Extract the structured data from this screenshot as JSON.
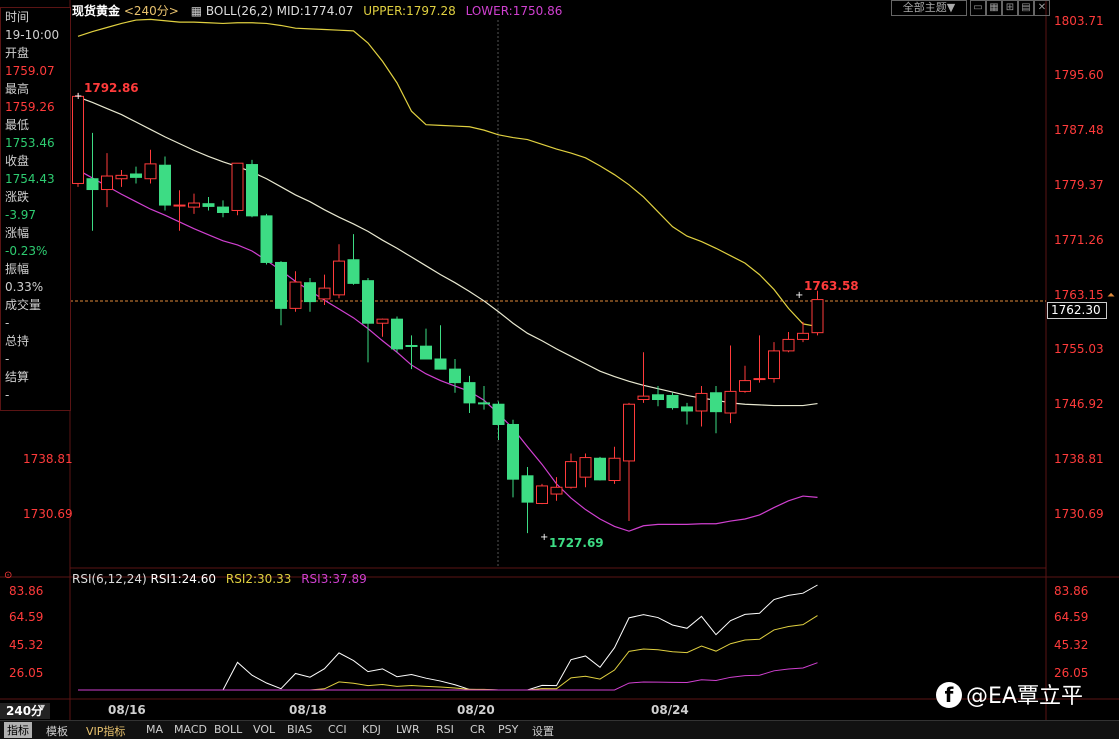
{
  "header": {
    "symbol": "现货黄金",
    "period": "<240分>",
    "boll_label": "BOLL(26,2)",
    "mid": "MID:1774.07",
    "upper": "UPPER:1797.28",
    "lower": "LOWER:1750.86",
    "theme_button": "全部主题▼"
  },
  "info_panel": {
    "time_label": "时间",
    "time_value": "19-10:00",
    "open_label": "开盘",
    "open_value": "1759.07",
    "high_label": "最高",
    "high_value": "1759.26",
    "low_label": "最低",
    "low_value": "1753.46",
    "close_label": "收盘",
    "close_value": "1754.43",
    "change_label": "涨跌",
    "change_value": "-3.97",
    "change_pct_label": "涨幅",
    "change_pct_value": "-0.23%",
    "amplitude_label": "振幅",
    "amplitude_value": "0.33%",
    "volume_label": "成交量",
    "volume_value": "-",
    "oi_label": "总持",
    "oi_value": "-",
    "settle_label": "结算",
    "settle_value": "-"
  },
  "right_axis": [
    "1803.71",
    "1795.60",
    "1787.48",
    "1779.37",
    "1771.26",
    "1763.15",
    "1755.03",
    "1746.92",
    "1738.81",
    "1730.69"
  ],
  "left_axis": [
    "1738.81",
    "1730.69"
  ],
  "current_price": "1762.30",
  "annotations": {
    "high_mark": "1792.86",
    "low_mark": "1727.69",
    "last_mark": "1763.58"
  },
  "rsi": {
    "label": "RSI(6,12,24)",
    "rsi1": "RSI1:24.60",
    "rsi2": "RSI2:30.33",
    "rsi3": "RSI3:37.89",
    "axis": [
      "83.86",
      "64.59",
      "45.32",
      "26.05"
    ]
  },
  "dates": [
    "08/16",
    "08/18",
    "08/20",
    "08/24"
  ],
  "period_button": "240分",
  "tabs": [
    "指标",
    "模板",
    "VIP指标",
    "MA",
    "MACD",
    "BOLL",
    "VOL",
    "BIAS",
    "CCI",
    "KDJ",
    "LWR",
    "RSI",
    "CR",
    "PSY",
    "设置"
  ],
  "watermark": "@EA覃立平",
  "colors": {
    "up": "#ff3b3b",
    "down": "#3ddc84",
    "mid": "#e8e8d0",
    "upper": "#e0d040",
    "lower": "#d040d0"
  },
  "chart_data": {
    "type": "candlestick",
    "candles": [
      {
        "o": 1779.5,
        "h": 1792.9,
        "l": 1779.0,
        "c": 1792.4
      },
      {
        "o": 1780.2,
        "h": 1787.0,
        "l": 1772.5,
        "c": 1778.6
      },
      {
        "o": 1778.6,
        "h": 1784.0,
        "l": 1776.0,
        "c": 1780.6
      },
      {
        "o": 1780.2,
        "h": 1781.5,
        "l": 1779.0,
        "c": 1780.7
      },
      {
        "o": 1780.9,
        "h": 1782.0,
        "l": 1779.5,
        "c": 1780.4
      },
      {
        "o": 1780.2,
        "h": 1784.5,
        "l": 1779.5,
        "c": 1782.4
      },
      {
        "o": 1782.2,
        "h": 1783.5,
        "l": 1775.5,
        "c": 1776.3
      },
      {
        "o": 1776.2,
        "h": 1778.5,
        "l": 1772.5,
        "c": 1776.3
      },
      {
        "o": 1776.0,
        "h": 1778.0,
        "l": 1775.0,
        "c": 1776.6
      },
      {
        "o": 1776.5,
        "h": 1777.5,
        "l": 1775.5,
        "c": 1776.1
      },
      {
        "o": 1776.0,
        "h": 1777.0,
        "l": 1774.5,
        "c": 1775.2
      },
      {
        "o": 1775.5,
        "h": 1782.5,
        "l": 1774.8,
        "c": 1782.5
      },
      {
        "o": 1782.3,
        "h": 1783.0,
        "l": 1774.5,
        "c": 1774.7
      },
      {
        "o": 1774.7,
        "h": 1775.0,
        "l": 1767.5,
        "c": 1767.8
      },
      {
        "o": 1767.8,
        "h": 1768.0,
        "l": 1758.5,
        "c": 1761.0
      },
      {
        "o": 1761.0,
        "h": 1766.5,
        "l": 1760.5,
        "c": 1764.9
      },
      {
        "o": 1764.8,
        "h": 1765.5,
        "l": 1760.5,
        "c": 1762.0
      },
      {
        "o": 1762.4,
        "h": 1766.0,
        "l": 1761.5,
        "c": 1764.0
      },
      {
        "o": 1763.0,
        "h": 1770.5,
        "l": 1762.5,
        "c": 1768.0
      },
      {
        "o": 1768.2,
        "h": 1772.0,
        "l": 1764.5,
        "c": 1764.7
      },
      {
        "o": 1765.1,
        "h": 1765.5,
        "l": 1753.0,
        "c": 1758.8
      },
      {
        "o": 1758.8,
        "h": 1759.5,
        "l": 1756.8,
        "c": 1759.4
      },
      {
        "o": 1759.4,
        "h": 1759.8,
        "l": 1754.5,
        "c": 1755.0
      },
      {
        "o": 1755.5,
        "h": 1757.0,
        "l": 1752.0,
        "c": 1755.4
      },
      {
        "o": 1755.4,
        "h": 1758.0,
        "l": 1753.5,
        "c": 1753.5
      },
      {
        "o": 1753.5,
        "h": 1758.5,
        "l": 1752.0,
        "c": 1752.0
      },
      {
        "o": 1752.0,
        "h": 1753.5,
        "l": 1748.5,
        "c": 1750.0
      },
      {
        "o": 1750.0,
        "h": 1751.0,
        "l": 1745.5,
        "c": 1747.0
      },
      {
        "o": 1747.0,
        "h": 1749.5,
        "l": 1746.0,
        "c": 1746.9
      },
      {
        "o": 1746.8,
        "h": 1747.2,
        "l": 1741.5,
        "c": 1743.8
      },
      {
        "o": 1743.8,
        "h": 1744.5,
        "l": 1733.0,
        "c": 1735.7
      },
      {
        "o": 1736.2,
        "h": 1737.5,
        "l": 1727.7,
        "c": 1732.3
      },
      {
        "o": 1732.1,
        "h": 1735.0,
        "l": 1732.0,
        "c": 1734.7
      },
      {
        "o": 1733.5,
        "h": 1736.0,
        "l": 1732.5,
        "c": 1734.5
      },
      {
        "o": 1734.5,
        "h": 1739.5,
        "l": 1734.3,
        "c": 1738.3
      },
      {
        "o": 1736.0,
        "h": 1739.5,
        "l": 1734.5,
        "c": 1738.9
      },
      {
        "o": 1738.8,
        "h": 1739.0,
        "l": 1735.5,
        "c": 1735.6
      },
      {
        "o": 1735.5,
        "h": 1740.5,
        "l": 1735.0,
        "c": 1738.8
      },
      {
        "o": 1738.4,
        "h": 1747.0,
        "l": 1729.5,
        "c": 1746.8
      },
      {
        "o": 1747.5,
        "h": 1754.5,
        "l": 1747.0,
        "c": 1748.0
      },
      {
        "o": 1748.2,
        "h": 1749.5,
        "l": 1746.5,
        "c": 1747.5
      },
      {
        "o": 1748.1,
        "h": 1748.5,
        "l": 1746.0,
        "c": 1746.3
      },
      {
        "o": 1746.4,
        "h": 1747.0,
        "l": 1743.8,
        "c": 1745.8
      },
      {
        "o": 1745.8,
        "h": 1749.5,
        "l": 1743.5,
        "c": 1748.4
      },
      {
        "o": 1748.5,
        "h": 1749.5,
        "l": 1742.5,
        "c": 1745.7
      },
      {
        "o": 1745.5,
        "h": 1755.5,
        "l": 1744.0,
        "c": 1748.7
      },
      {
        "o": 1748.7,
        "h": 1752.5,
        "l": 1748.5,
        "c": 1750.3
      },
      {
        "o": 1750.5,
        "h": 1757.0,
        "l": 1750.0,
        "c": 1750.6
      },
      {
        "o": 1750.6,
        "h": 1756.0,
        "l": 1750.0,
        "c": 1754.7
      },
      {
        "o": 1754.7,
        "h": 1757.5,
        "l": 1754.5,
        "c": 1756.4
      },
      {
        "o": 1756.4,
        "h": 1759.0,
        "l": 1756.0,
        "c": 1757.3
      },
      {
        "o": 1757.4,
        "h": 1763.6,
        "l": 1757.0,
        "c": 1762.3
      }
    ],
    "boll_mid": [
      1792.3,
      1791.5,
      1790.6,
      1789.7,
      1788.6,
      1787.5,
      1786.4,
      1785.4,
      1784.4,
      1783.5,
      1782.7,
      1782.0,
      1781.2,
      1780.2,
      1779.0,
      1777.8,
      1776.8,
      1775.6,
      1774.5,
      1773.5,
      1772.4,
      1771.1,
      1769.9,
      1768.6,
      1767.3,
      1766.0,
      1764.8,
      1763.5,
      1762.1,
      1760.5,
      1758.8,
      1757.3,
      1756.2,
      1755.0,
      1753.9,
      1752.8,
      1751.7,
      1750.9,
      1750.2,
      1749.6,
      1749.1,
      1748.6,
      1748.1,
      1747.7,
      1747.4,
      1747.0,
      1746.8,
      1746.7,
      1746.6,
      1746.6,
      1746.6,
      1746.9
    ],
    "boll_upper": [
      1801.3,
      1802.0,
      1802.6,
      1803.2,
      1803.7,
      1803.8,
      1803.6,
      1803.4,
      1803.4,
      1803.3,
      1803.2,
      1803.3,
      1803.3,
      1803.2,
      1802.9,
      1802.5,
      1802.4,
      1802.3,
      1802.2,
      1802.1,
      1800.3,
      1797.6,
      1794.4,
      1790.2,
      1788.2,
      1788.1,
      1788.0,
      1787.9,
      1787.4,
      1786.7,
      1786.3,
      1786.0,
      1785.3,
      1784.6,
      1784.0,
      1783.3,
      1782.1,
      1780.8,
      1779.3,
      1777.5,
      1775.3,
      1773.1,
      1771.7,
      1770.9,
      1769.9,
      1768.8,
      1767.7,
      1766.0,
      1763.8,
      1761.0,
      1758.7,
      1758.3
    ],
    "boll_lower": [
      1781.5,
      1780.3,
      1779.1,
      1777.9,
      1776.8,
      1775.7,
      1774.8,
      1773.8,
      1772.8,
      1771.9,
      1771.0,
      1770.4,
      1769.5,
      1768.1,
      1766.6,
      1765.0,
      1763.6,
      1762.2,
      1760.9,
      1759.6,
      1758.0,
      1756.2,
      1754.5,
      1752.6,
      1751.3,
      1750.3,
      1749.5,
      1748.7,
      1747.4,
      1745.4,
      1743.2,
      1740.5,
      1737.9,
      1735.0,
      1732.9,
      1731.2,
      1729.8,
      1728.7,
      1728.0,
      1728.8,
      1729.0,
      1729.0,
      1729.0,
      1729.1,
      1729.1,
      1729.5,
      1729.8,
      1730.4,
      1731.5,
      1732.5,
      1733.2,
      1733.0
    ]
  }
}
